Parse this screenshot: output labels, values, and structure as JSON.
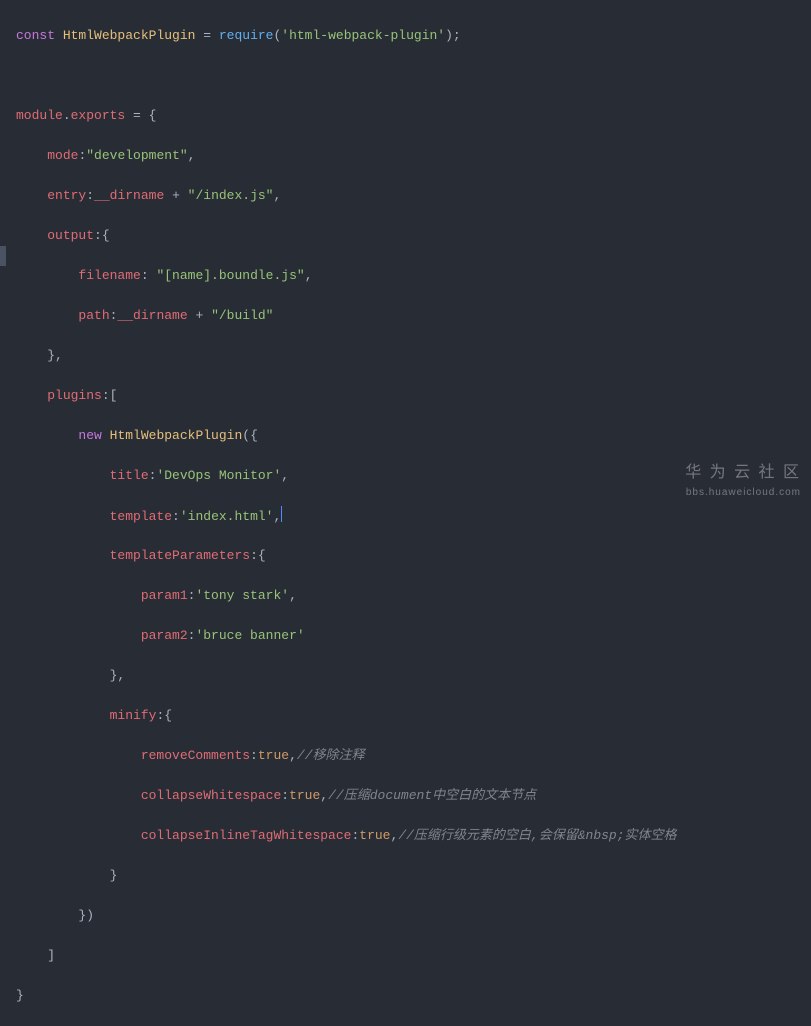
{
  "code": {
    "l1": {
      "kw_const": "const",
      "name": "HtmlWebpackPlugin",
      "eq": " = ",
      "fn": "require",
      "open": "(",
      "arg": "'html-webpack-plugin'",
      "close": ");"
    },
    "l3": {
      "obj": "module",
      "dot": ".",
      "prop": "exports",
      "eq": " = {"
    },
    "l4": {
      "key": "mode",
      "colon": ":",
      "val": "\"development\"",
      "comma": ","
    },
    "l5": {
      "key": "entry",
      "colon": ":",
      "dir": "__dirname",
      "plus": " + ",
      "val": "\"/index.js\"",
      "comma": ","
    },
    "l6": {
      "key": "output",
      "colon": ":{"
    },
    "l7": {
      "key": "filename",
      "colon": ": ",
      "val": "\"[name].boundle.js\"",
      "comma": ","
    },
    "l8": {
      "key": "path",
      "colon": ":",
      "dir": "__dirname",
      "plus": " + ",
      "val": "\"/build\""
    },
    "l9": {
      "close": "},"
    },
    "l10": {
      "key": "plugins",
      "colon": ":["
    },
    "l11": {
      "kw_new": "new",
      "cls": "HtmlWebpackPlugin",
      "open": "({"
    },
    "l12": {
      "key": "title",
      "colon": ":",
      "val": "'DevOps Monitor'",
      "comma": ","
    },
    "l13": {
      "key": "template",
      "colon": ":",
      "val": "'index.html'",
      "comma": ","
    },
    "l14": {
      "key": "templateParameters",
      "colon": ":{"
    },
    "l15": {
      "key": "param1",
      "colon": ":",
      "val": "'tony stark'",
      "comma": ","
    },
    "l16": {
      "key": "param2",
      "colon": ":",
      "val": "'bruce banner'"
    },
    "l17": {
      "close": "},"
    },
    "l18": {
      "key": "minify",
      "colon": ":{"
    },
    "l19": {
      "key": "removeComments",
      "colon": ":",
      "val": "true",
      "comma": ",",
      "comment": "//移除注释"
    },
    "l20": {
      "key": "collapseWhitespace",
      "colon": ":",
      "val": "true",
      "comma": ",",
      "comment": "//压缩document中空白的文本节点"
    },
    "l21": {
      "key": "collapseInlineTagWhitespace",
      "colon": ":",
      "val": "true",
      "comma": ",",
      "comment": "//压缩行级元素的空白,会保留&nbsp;实体空格"
    },
    "l22": {
      "close": "}"
    },
    "l23": {
      "close": "})"
    },
    "l24": {
      "close": "]"
    },
    "l25": {
      "close": "}"
    }
  },
  "watermark": {
    "big": "华 为 云 社 区",
    "small": "bbs.huaweicloud.com"
  }
}
